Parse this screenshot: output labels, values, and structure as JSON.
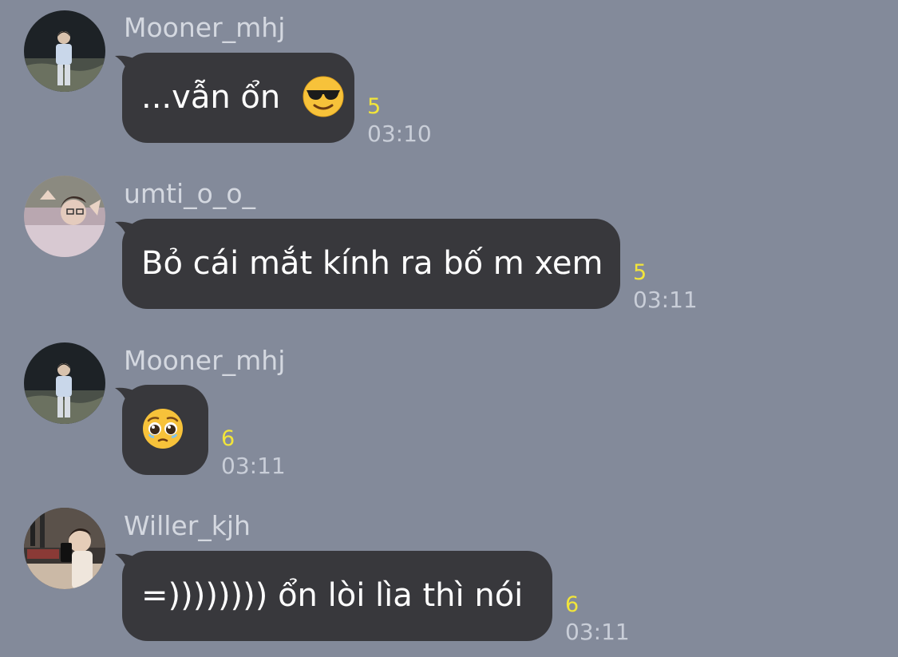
{
  "messages": [
    {
      "sender": "Mooner_mhj",
      "text": "...vẫn ổn",
      "emoji": "smiling-face-with-sunglasses-icon",
      "read_count": "5",
      "time": "03:10"
    },
    {
      "sender": "umti_o_o_",
      "text": "Bỏ cái mắt kính ra bố m xem",
      "read_count": "5",
      "time": "03:11"
    },
    {
      "sender": "Mooner_mhj",
      "text": "",
      "emoji": "pleading-face-icon",
      "read_count": "6",
      "time": "03:11"
    },
    {
      "sender": "Willer_kjh",
      "text": "=)))))))) ổn lòi lìa thì nói",
      "read_count": "6",
      "time": "03:11"
    }
  ],
  "colors": {
    "background": "#838a9a",
    "bubble": "#38383c",
    "unread_count": "#f2e53a",
    "sender_name": "#d4d8e0",
    "timestamp": "#c9ced8"
  }
}
